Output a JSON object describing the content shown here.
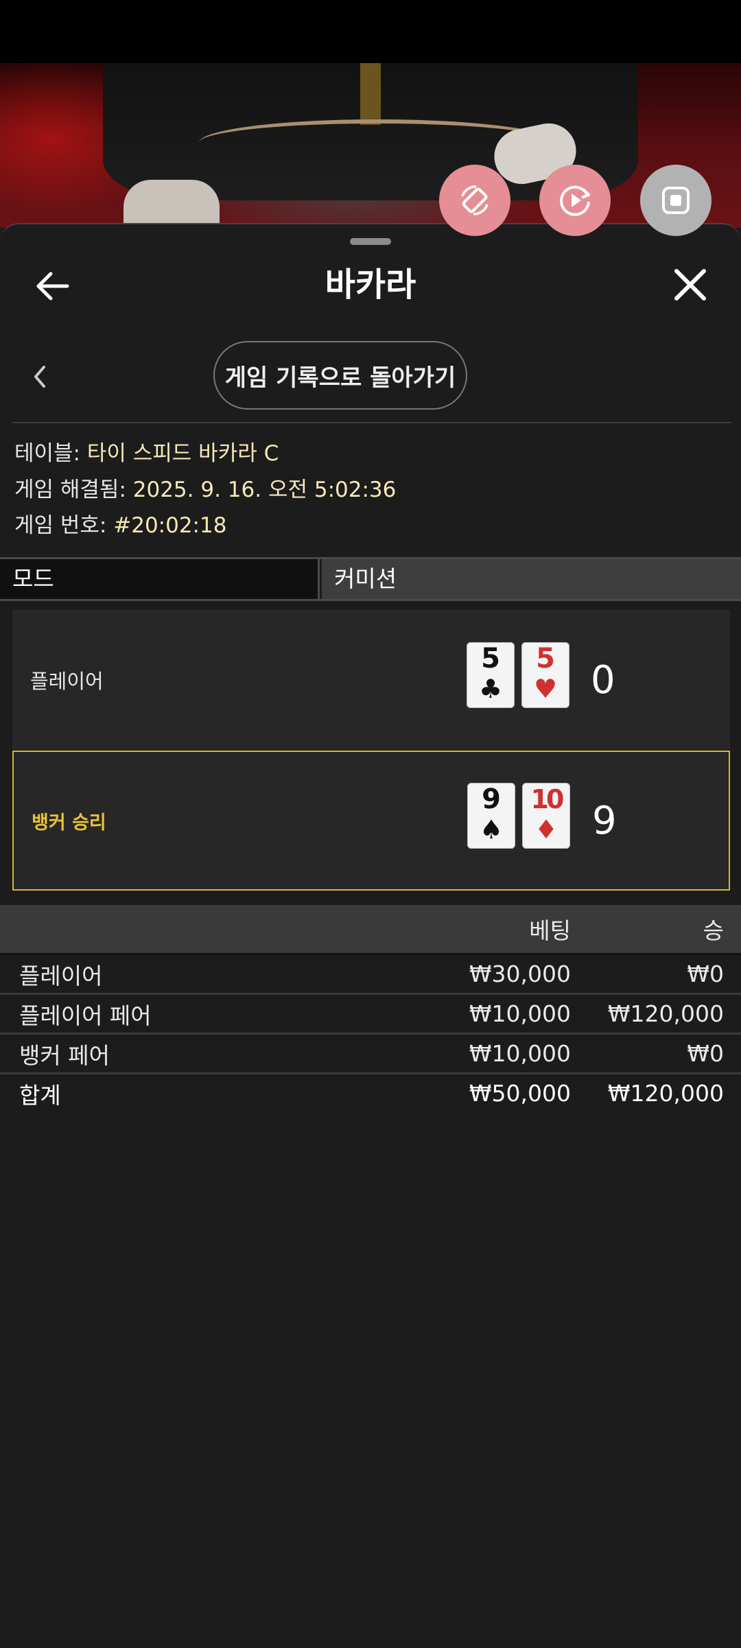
{
  "header": {
    "title": "바카라",
    "history_button": "게임 기록으로 돌아가기"
  },
  "info": {
    "table_label": "테이블:",
    "table_value": "타이 스피드 바카라 C",
    "resolved_label": "게임 해결됨:",
    "resolved_value": "2025. 9. 16. 오전 5:02:36",
    "number_label": "게임 번호:",
    "number_value": "#20:02:18"
  },
  "mode": {
    "label": "모드",
    "value": "커미션"
  },
  "hands": {
    "player": {
      "label": "플레이어",
      "cards": [
        {
          "rank": "5",
          "suit": "♣"
        },
        {
          "rank": "5",
          "suit": "♥"
        }
      ],
      "score": "0"
    },
    "banker": {
      "label": "뱅커 승리",
      "cards": [
        {
          "rank": "9",
          "suit": "♠"
        },
        {
          "rank": "10",
          "suit": "♦"
        }
      ],
      "score": "9"
    }
  },
  "bets": {
    "headers": {
      "bet": "베팅",
      "win": "승"
    },
    "rows": [
      {
        "name": "플레이어",
        "bet": "₩30,000",
        "win": "₩0"
      },
      {
        "name": "플레이어 페어",
        "bet": "₩10,000",
        "win": "₩120,000"
      },
      {
        "name": "뱅커 페어",
        "bet": "₩10,000",
        "win": "₩0"
      }
    ],
    "total": {
      "name": "합계",
      "bet": "₩50,000",
      "win": "₩120,000"
    }
  },
  "icons": {
    "rotate": "rotate-device-icon",
    "autoplay": "autoplay-icon",
    "stop": "stop-icon",
    "back": "back-arrow-icon",
    "close": "close-icon",
    "chevron": "chevron-left-icon"
  },
  "colors": {
    "accent_gold": "#e8c23a",
    "info_value": "#f6e9b8",
    "float_button_pink": "#e58e95",
    "float_button_grey": "#b2b2b2"
  }
}
